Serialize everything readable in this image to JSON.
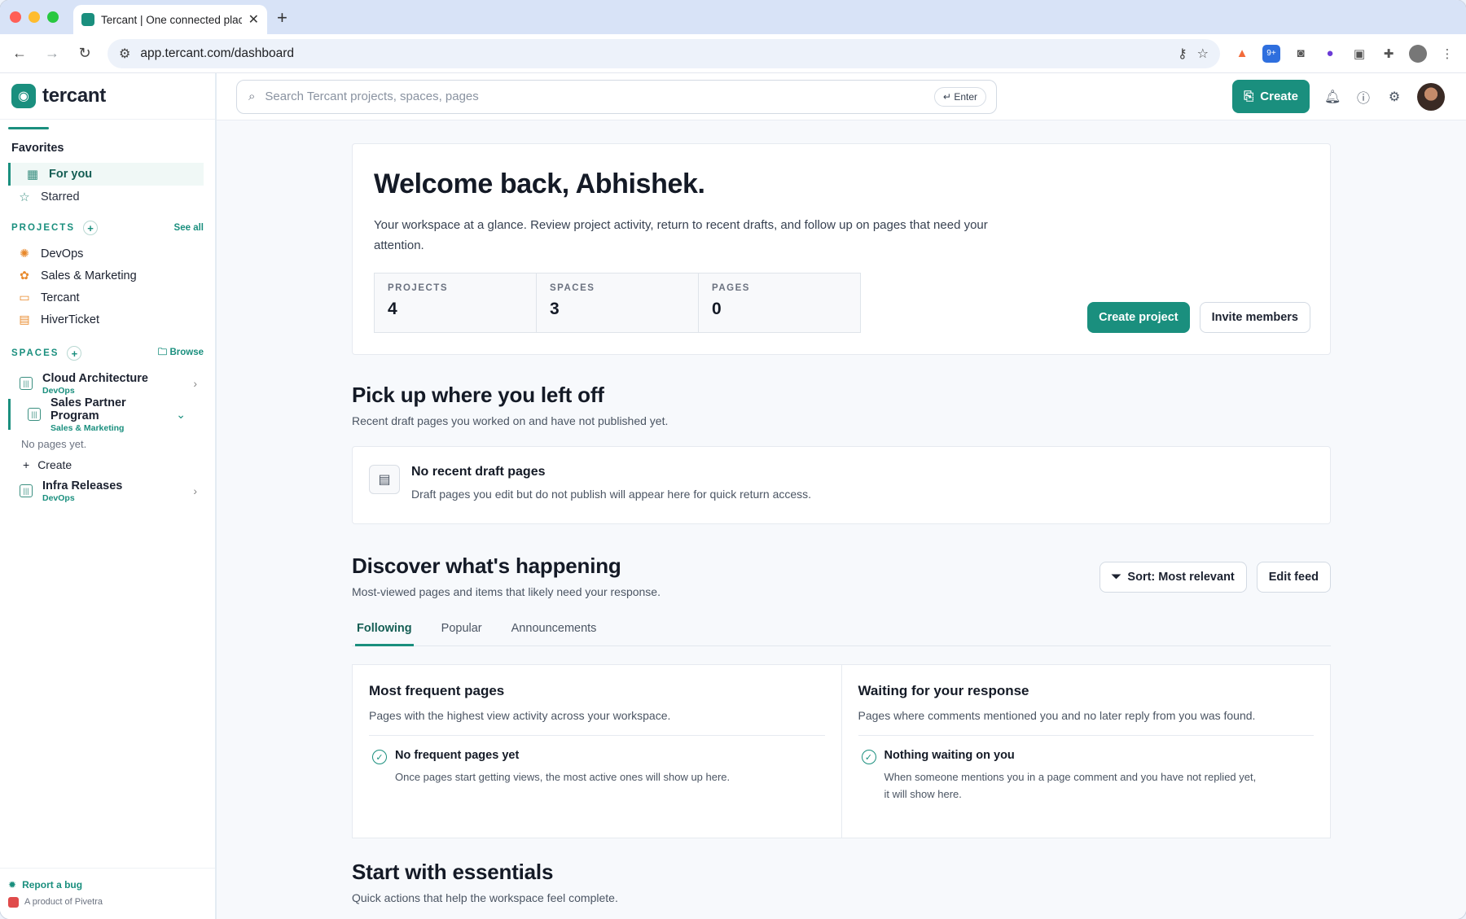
{
  "browser": {
    "tab_title": "Tercant | One connected plac",
    "url": "app.tercant.com/dashboard"
  },
  "sidebar": {
    "logo_text": "tercant",
    "favorites_title": "Favorites",
    "favorites": [
      {
        "label": "For you",
        "icon": "grid-icon"
      },
      {
        "label": "Starred",
        "icon": "star-icon"
      }
    ],
    "projects_title": "PROJECTS",
    "projects_see_all": "See all",
    "projects": [
      {
        "label": "DevOps",
        "icon": "sun-icon"
      },
      {
        "label": "Sales & Marketing",
        "icon": "puzzle-icon"
      },
      {
        "label": "Tercant",
        "icon": "video-icon"
      },
      {
        "label": "HiverTicket",
        "icon": "archive-icon"
      }
    ],
    "spaces_title": "SPACES",
    "spaces_browse": "Browse",
    "spaces": [
      {
        "name": "Cloud Architecture",
        "project": "DevOps"
      },
      {
        "name": "Sales Partner Program",
        "project": "Sales & Marketing"
      },
      {
        "name": "Infra Releases",
        "project": "DevOps"
      }
    ],
    "no_pages": "No pages yet.",
    "create_label": "Create",
    "report_bug": "Report a bug",
    "product_of": "A product of Pivetra"
  },
  "topbar": {
    "search_placeholder": "Search Tercant projects, spaces, pages",
    "enter_hint": "Enter",
    "create_label": "Create"
  },
  "welcome": {
    "title": "Welcome back, Abhishek.",
    "text": "Your workspace at a glance. Review project activity, return to recent drafts, and follow up on pages that need your attention.",
    "stats": [
      {
        "label": "PROJECTS",
        "value": "4"
      },
      {
        "label": "SPACES",
        "value": "3"
      },
      {
        "label": "PAGES",
        "value": "0"
      }
    ],
    "create_project": "Create project",
    "invite_members": "Invite members"
  },
  "pickup": {
    "title": "Pick up where you left off",
    "subtitle": "Recent draft pages you worked on and have not published yet.",
    "empty_title": "No recent draft pages",
    "empty_text": "Draft pages you edit but do not publish will appear here for quick return access."
  },
  "discover": {
    "title": "Discover what's happening",
    "subtitle": "Most-viewed pages and items that likely need your response.",
    "sort_label": "Sort: Most relevant",
    "edit_feed": "Edit feed",
    "tabs": [
      "Following",
      "Popular",
      "Announcements"
    ],
    "frequent": {
      "title": "Most frequent pages",
      "subtitle": "Pages with the highest view activity across your workspace.",
      "empty_title": "No frequent pages yet",
      "empty_text": "Once pages start getting views, the most active ones will show up here."
    },
    "waiting": {
      "title": "Waiting for your response",
      "subtitle": "Pages where comments mentioned you and no later reply from you was found.",
      "empty_title": "Nothing waiting on you",
      "empty_text": "When someone mentions you in a page comment and you have not replied yet, it will show here."
    }
  },
  "essentials": {
    "title": "Start with essentials",
    "subtitle": "Quick actions that help the workspace feel complete."
  },
  "colors": {
    "brand": "#1a8f7e",
    "tabbar": "#d8e3f7"
  }
}
